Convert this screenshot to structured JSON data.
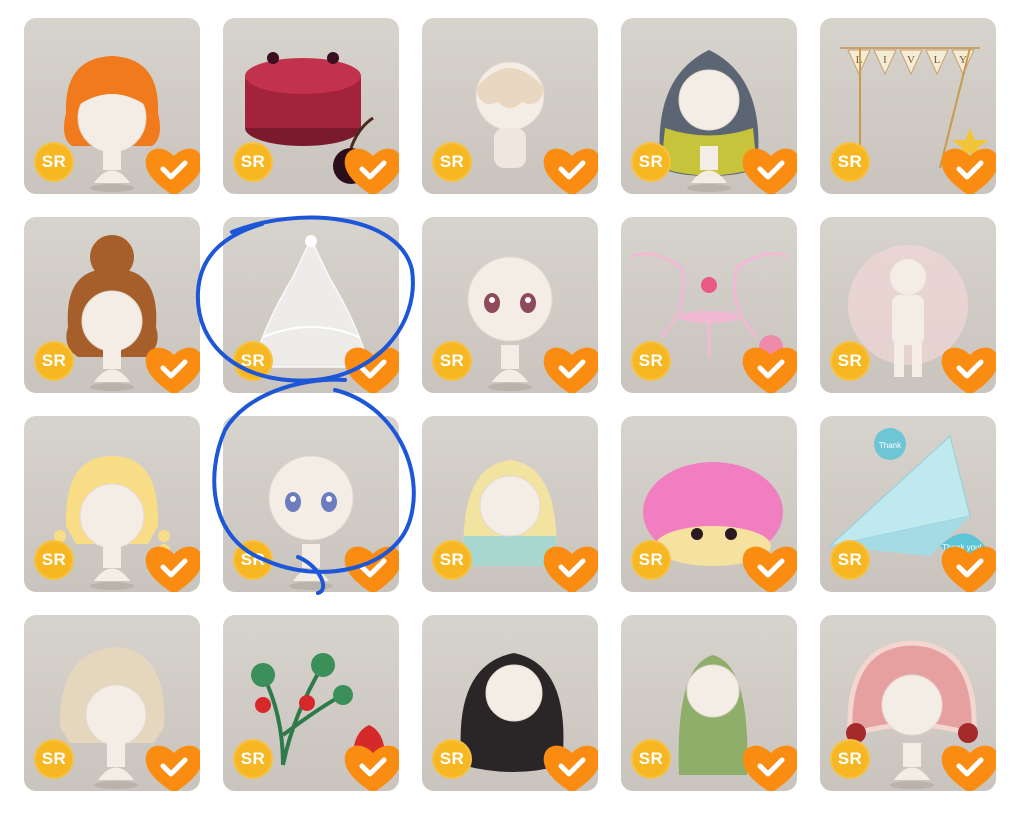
{
  "items": [
    {
      "badge": "SR",
      "art": "hair-orange-bob"
    },
    {
      "badge": "SR",
      "art": "cherry-cake"
    },
    {
      "badge": "SR",
      "art": "cream-hat-head"
    },
    {
      "badge": "SR",
      "art": "hair-gray-yellow-wavy"
    },
    {
      "badge": "SR",
      "art": "livly-garland",
      "art_text": [
        "L",
        "I",
        "V",
        "L",
        "Y"
      ]
    },
    {
      "badge": "SR",
      "art": "hair-brown-bun"
    },
    {
      "badge": "SR",
      "art": "crystal-chandelier-dress"
    },
    {
      "badge": "SR",
      "art": "face-pink-eyes"
    },
    {
      "badge": "SR",
      "art": "pink-table-set"
    },
    {
      "badge": "SR",
      "art": "body-aura-pink"
    },
    {
      "badge": "SR",
      "art": "hair-blonde-braids"
    },
    {
      "badge": "SR",
      "art": "face-blue-eyes"
    },
    {
      "badge": "SR",
      "art": "hair-yellow-teal"
    },
    {
      "badge": "SR",
      "art": "pink-fluffy-creature"
    },
    {
      "badge": "SR",
      "art": "paper-plane-thankyou",
      "art_text": [
        "Thank",
        "Thank you!"
      ]
    },
    {
      "badge": "SR",
      "art": "hair-beige-braids"
    },
    {
      "badge": "SR",
      "art": "strawberry-plant"
    },
    {
      "badge": "SR",
      "art": "hair-black-curly"
    },
    {
      "badge": "SR",
      "art": "hair-green-long"
    },
    {
      "badge": "SR",
      "art": "hair-pink-bonnet"
    }
  ],
  "colors": {
    "badge": "#f6b722",
    "heart": "#fa8c12",
    "annotation": "#1e56d8"
  }
}
